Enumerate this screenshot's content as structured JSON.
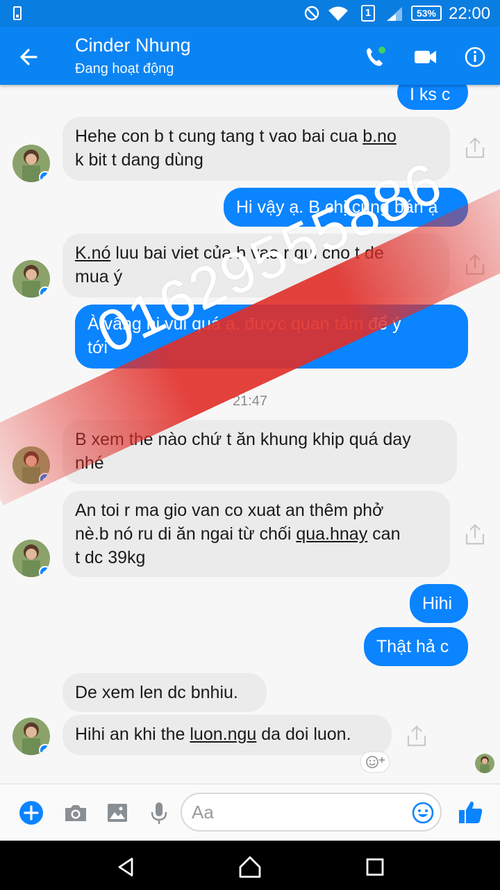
{
  "status_bar": {
    "time": "22:00",
    "battery": "53%",
    "sim_slot": "1"
  },
  "header": {
    "contact_name": "Cinder Nhung",
    "status": "Đang hoạt động",
    "icons": [
      "back-arrow-icon",
      "phone-icon",
      "video-camera-icon",
      "info-icon"
    ]
  },
  "messages": [
    {
      "side": "out",
      "text": "I ks c"
    },
    {
      "side": "in",
      "parts": [
        [
          "Hehe con b t cung tang t vao bai cua ",
          false
        ],
        [
          "b.no",
          true
        ],
        [
          "\nk bit t dang dùng",
          false
        ]
      ]
    },
    {
      "side": "out",
      "text": "Hi vậy ạ. B chị cung bán ạ"
    },
    {
      "side": "in",
      "parts": [
        [
          "K.nó",
          true
        ],
        [
          " luu bai viet của b vao r gui cho t de\nmua ý",
          false
        ]
      ]
    },
    {
      "side": "out",
      "text": "À vâng hi vui quá ạ. được quan tâm để ý\ntới"
    },
    {
      "side": "in",
      "text": "B xem the nào chứ t ăn khung khip quá day\nnhé"
    },
    {
      "side": "in",
      "parts": [
        [
          "An toi r ma gio van co xuat an thêm phở\nnè.b nó ru di ăn ngai từ chối ",
          false
        ],
        [
          "qua.hnay",
          true
        ],
        [
          " can\nt dc 39kg",
          false
        ]
      ]
    },
    {
      "side": "out",
      "text": "Hihi"
    },
    {
      "side": "out",
      "text": "Thật hả c"
    },
    {
      "side": "in",
      "text": "De xem len dc bnhiu."
    },
    {
      "side": "in",
      "parts": [
        [
          "Hihi an khi the ",
          false
        ],
        [
          "luon.ngu",
          true
        ],
        [
          " da doi luon.",
          false
        ]
      ]
    }
  ],
  "timestamp": "21:47",
  "watermark": "01629555886",
  "composer": {
    "placeholder": "Aa",
    "icons": [
      "plus-icon",
      "camera-icon",
      "image-icon",
      "microphone-icon",
      "emoji-icon",
      "like-icon"
    ]
  },
  "colors": {
    "header_blue": "#0b84f3",
    "statusbar_blue": "#0a7de0",
    "outgoing_bubble": "#0b84ff",
    "incoming_bubble": "#ebebeb",
    "watermark_red": "#e12d28"
  }
}
